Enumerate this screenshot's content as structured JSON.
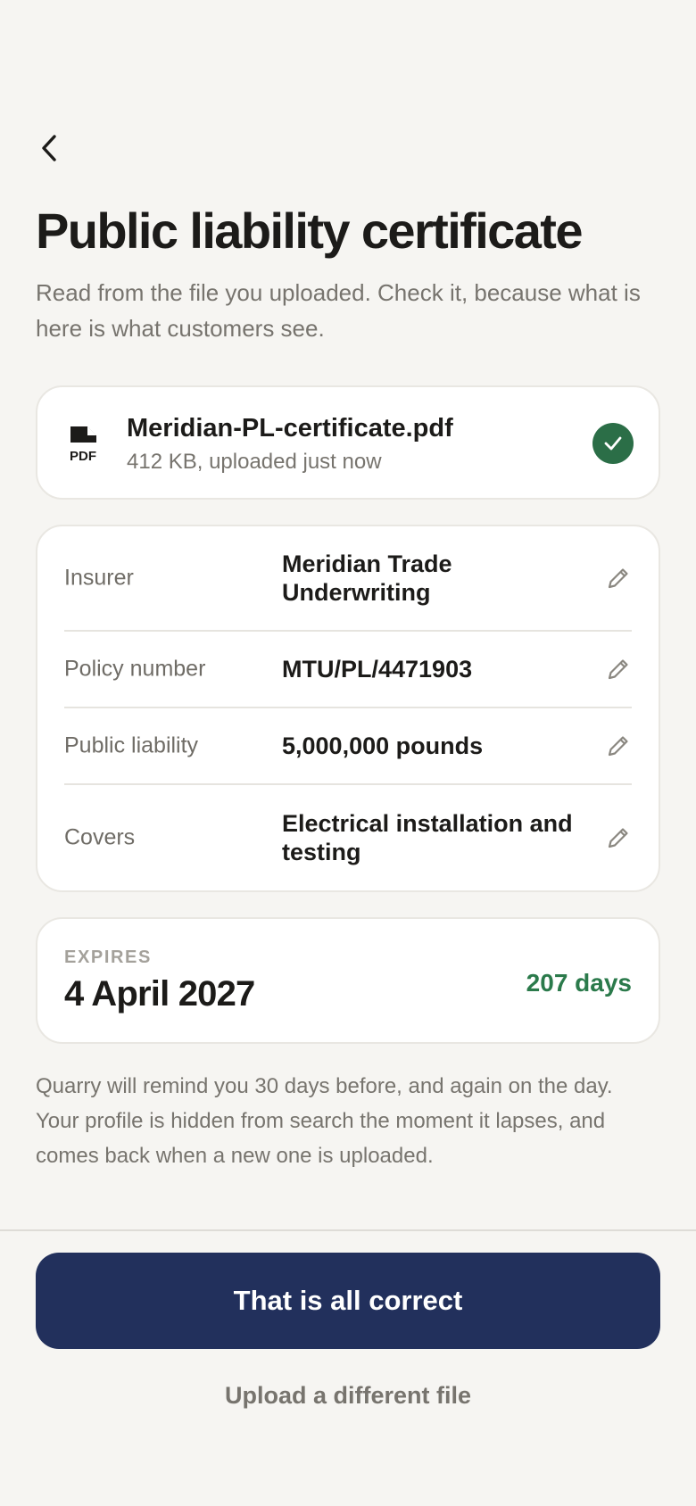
{
  "header": {
    "back_icon": "chevron-left-icon",
    "title": "Public liability certificate",
    "subtitle": "Read from the file you uploaded. Check it, because what is here is what customers see."
  },
  "file": {
    "icon": "pdf-file-icon",
    "icon_text": "PDF",
    "name": "Meridian-PL-certificate.pdf",
    "meta": "412 KB, uploaded just now",
    "status_icon": "check-circle-icon",
    "status_color": "#2b6e47"
  },
  "details": [
    {
      "label": "Insurer",
      "value": "Meridian Trade Underwriting",
      "edit_icon": "pencil-icon"
    },
    {
      "label": "Policy number",
      "value": "MTU/PL/4471903",
      "edit_icon": "pencil-icon"
    },
    {
      "label": "Public liability",
      "value": "5,000,000 pounds",
      "edit_icon": "pencil-icon"
    },
    {
      "label": "Covers",
      "value": "Electrical installation and testing",
      "edit_icon": "pencil-icon"
    }
  ],
  "expiry": {
    "label": "EXPIRES",
    "date": "4 April 2027",
    "remaining": "207 days",
    "remaining_color": "#2b7a4b"
  },
  "reminder_text": "Quarry will remind you 30 days before, and again on the day. Your profile is hidden from search the moment it lapses, and comes back when a new one is uploaded.",
  "actions": {
    "confirm_label": "That is all correct",
    "confirm_color": "#22305c",
    "upload_label": "Upload a different file"
  }
}
